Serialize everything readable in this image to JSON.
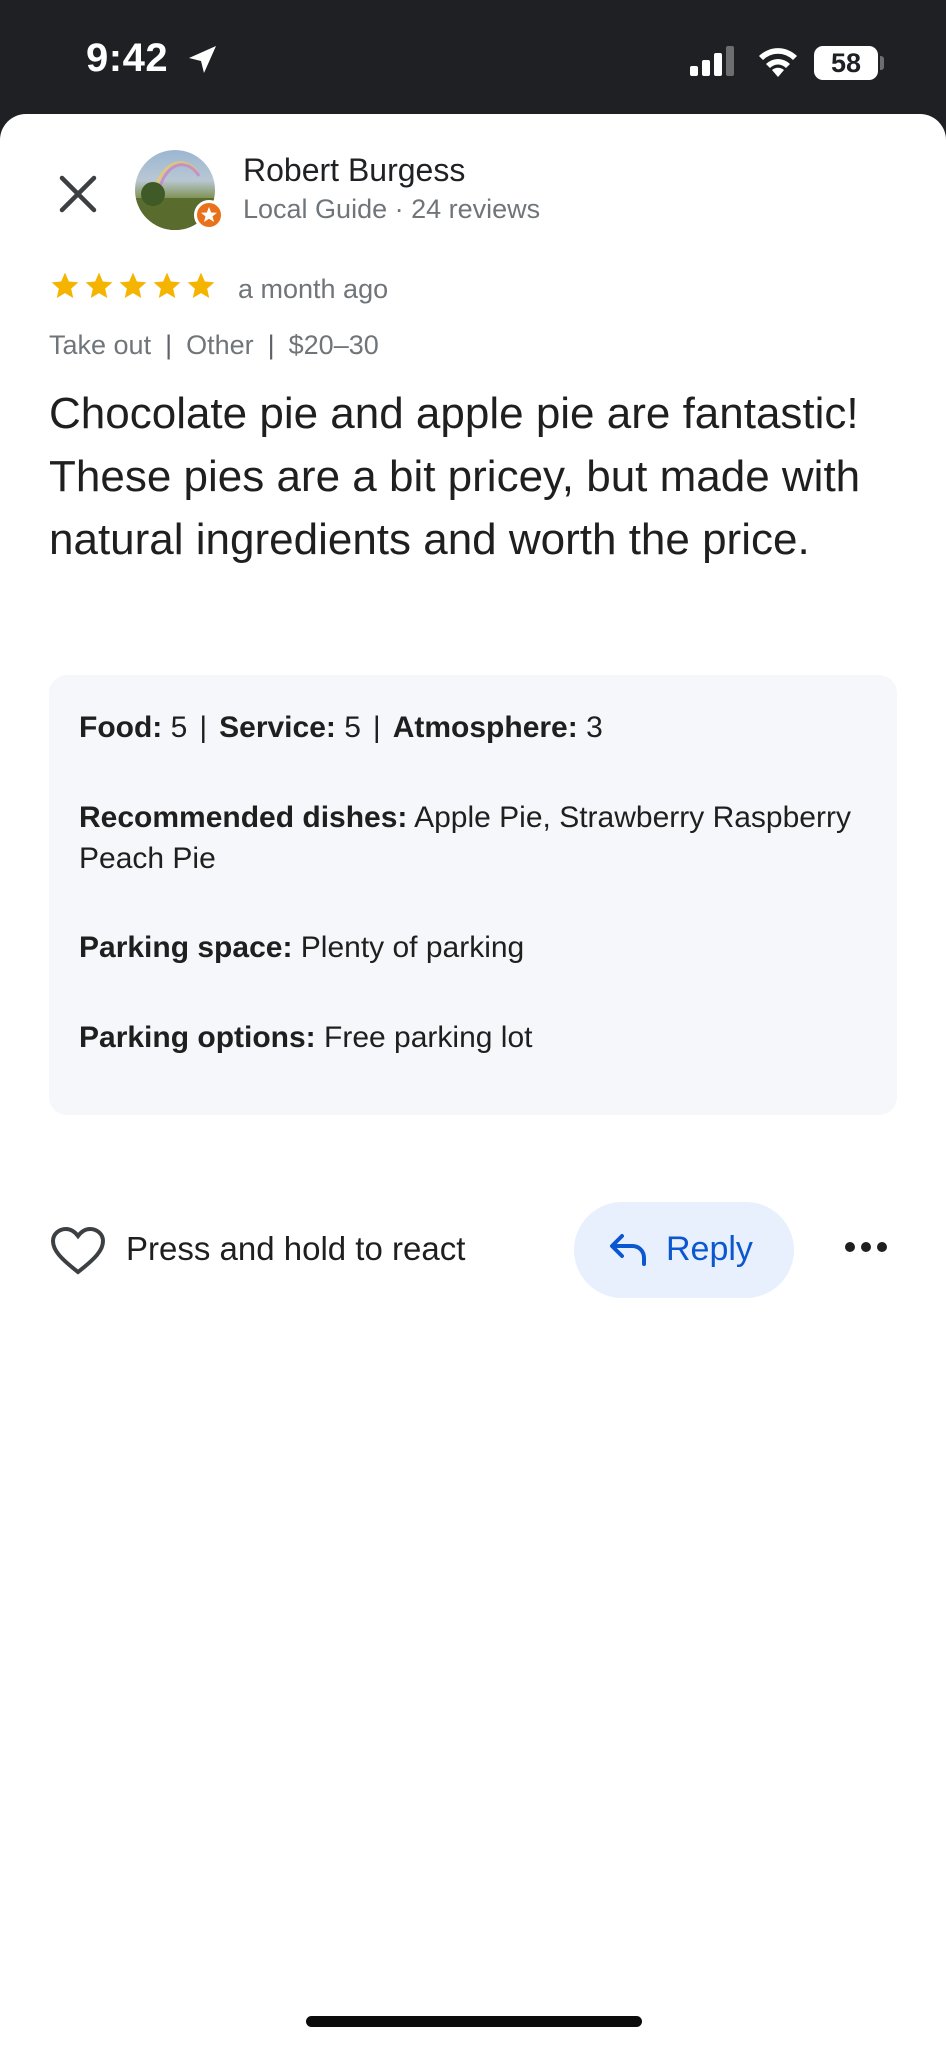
{
  "status_bar": {
    "time": "9:42",
    "battery": "58"
  },
  "reviewer": {
    "name": "Robert Burgess",
    "meta": "Local Guide · 24 reviews"
  },
  "rating": {
    "stars": 5,
    "star_color": "#f4b400",
    "when": "a month ago"
  },
  "tags": [
    "Take out",
    "Other",
    "$20–30"
  ],
  "review_text": "Chocolate pie and apple pie are fantastic! These pies are a bit pricey, but made with natural ingredients and worth the price.",
  "details": {
    "food_label": "Food:",
    "food_value": "5",
    "service_label": "Service:",
    "service_value": "5",
    "atmosphere_label": "Atmosphere:",
    "atmosphere_value": "3",
    "recommended_label": "Recommended dishes:",
    "recommended_value": "Apple Pie, Strawberry Raspberry Peach Pie",
    "parking_space_label": "Parking space:",
    "parking_space_value": "Plenty of parking",
    "parking_options_label": "Parking options:",
    "parking_options_value": "Free parking lot"
  },
  "actions": {
    "react_label": "Press and hold to react",
    "reply_label": "Reply"
  },
  "colors": {
    "accent_blue": "#0b57d0",
    "reply_bg": "#e8f0fe",
    "local_guide_orange": "#e8711a"
  }
}
